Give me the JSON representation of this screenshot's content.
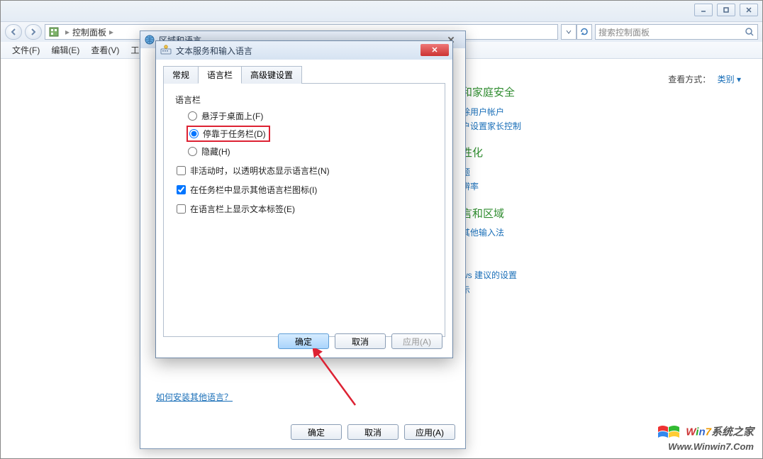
{
  "chrome": {
    "min": "—",
    "max": "□",
    "close": "×"
  },
  "nav": {
    "breadcrumb_root": "控制面板",
    "search_placeholder": "搜索控制面板"
  },
  "menu": {
    "file": "文件(F)",
    "edit": "编辑(E)",
    "view": "查看(V)",
    "tool": "工"
  },
  "view_mode": {
    "label": "查看方式：",
    "value": "类别"
  },
  "categories": {
    "items": [
      {
        "head": "和家庭安全",
        "links": [
          "除用户帐户",
          "户设置家长控制"
        ]
      },
      {
        "head": "性化",
        "links": [
          "题",
          "辨率"
        ]
      },
      {
        "head": "言和区域",
        "links": [
          "其他输入法"
        ]
      },
      {
        "head": "",
        "links": [
          "ws 建议的设置",
          "示"
        ]
      }
    ]
  },
  "region_dialog": {
    "title": "区域和语言",
    "how_link": "如何安装其他语言？",
    "ok": "确定",
    "cancel": "取消",
    "apply": "应用(A)"
  },
  "lang_dialog": {
    "title": "文本服务和输入语言",
    "tabs": {
      "general": "常规",
      "langbar": "语言栏",
      "advanced": "高级键设置"
    },
    "group": "语言栏",
    "radio_float": "悬浮于桌面上(F)",
    "radio_dock": "停靠于任务栏(D)",
    "radio_hide": "隐藏(H)",
    "chk_inactive": "非活动时，以透明状态显示语言栏(N)",
    "chk_icons": "在任务栏中显示其他语言栏图标(I)",
    "chk_labels": "在语言栏上显示文本标签(E)",
    "ok": "确定",
    "cancel": "取消",
    "apply": "应用(A)"
  },
  "watermark": {
    "line1": "Win7系统之家",
    "line2": "Www.Winwin7.Com"
  }
}
